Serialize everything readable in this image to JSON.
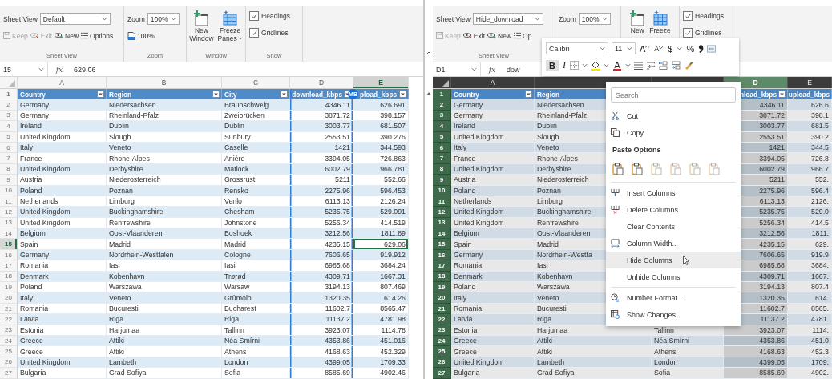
{
  "windows": [
    {
      "ribbon": [
        {
          "kind": "sheet_view",
          "label": "Sheet View",
          "dropdown_label": "Sheet View",
          "value": "Default",
          "buttons": [
            {
              "label": "Keep",
              "disabled": true
            },
            {
              "label": "Exit",
              "disabled": true
            },
            {
              "label": "New",
              "disabled": false
            },
            {
              "label": "Options",
              "disabled": false
            }
          ]
        },
        {
          "kind": "zoom",
          "label": "Zoom",
          "dropdown_label": "Zoom",
          "value": "100%",
          "button": "100%"
        },
        {
          "kind": "window",
          "label": "Window",
          "buttons": [
            {
              "lines": [
                "New",
                "Window"
              ],
              "dropdown": false
            },
            {
              "lines": [
                "Freeze",
                "Panes"
              ],
              "dropdown": true
            }
          ]
        },
        {
          "kind": "show",
          "label": "Show",
          "checkboxes": [
            {
              "label": "Headings",
              "checked": true
            },
            {
              "label": "Gridlines",
              "checked": true
            }
          ]
        }
      ],
      "formula_bar": {
        "name_box": "15",
        "function_label": "fx",
        "value": "629.06"
      },
      "sheet": {
        "column_letters": {
          "country": {
            "label": "A",
            "selected": false,
            "whole_column": false
          },
          "region": {
            "label": "B",
            "selected": false,
            "whole_column": false
          },
          "city": {
            "label": "C",
            "selected": false,
            "whole_column": false
          },
          "download": {
            "label": "D",
            "selected": false,
            "whole_column": false,
            "collaborator_initials": "MB"
          },
          "upload": {
            "label": "E",
            "selected": true,
            "whole_column": false
          }
        },
        "header_row": {
          "number": "1",
          "cells": {
            "country": "Country",
            "region": "Region",
            "city": "City",
            "download": "download_kbps",
            "upload": "pload_kbps"
          }
        },
        "rows": [
          {
            "number": "2",
            "selected": false,
            "country": "Germany",
            "region": "Niedersachsen",
            "city": "Braunschweig",
            "download": "4346.11",
            "upload": "626.691"
          },
          {
            "number": "3",
            "selected": false,
            "country": "Germany",
            "region": "Rheinland-Pfalz",
            "city": "Zweibrücken",
            "download": "3871.72",
            "upload": "398.157"
          },
          {
            "number": "4",
            "selected": false,
            "country": "Ireland",
            "region": "Dublin",
            "city": "Dublin",
            "download": "3003.77",
            "upload": "681.507"
          },
          {
            "number": "5",
            "selected": false,
            "country": "United Kingdom",
            "region": "Slough",
            "city": "Sunbury",
            "download": "2553.51",
            "upload": "390.276"
          },
          {
            "number": "6",
            "selected": false,
            "country": "Italy",
            "region": "Veneto",
            "city": "Caselle",
            "download": "1421",
            "upload": "344.593"
          },
          {
            "number": "7",
            "selected": false,
            "country": "France",
            "region": "Rhone-Alpes",
            "city": "Anière",
            "download": "3394.05",
            "upload": "726.863"
          },
          {
            "number": "8",
            "selected": false,
            "country": "United Kingdom",
            "region": "Derbyshire",
            "city": "Matlock",
            "download": "6002.79",
            "upload": "966.781"
          },
          {
            "number": "9",
            "selected": false,
            "country": "Austria",
            "region": "Niederosterreich",
            "city": "Grossrust",
            "download": "5211",
            "upload": "552.66"
          },
          {
            "number": "10",
            "selected": false,
            "country": "Poland",
            "region": "Poznan",
            "city": "Rensko",
            "download": "2275.96",
            "upload": "596.453"
          },
          {
            "number": "11",
            "selected": false,
            "country": "Netherlands",
            "region": "Limburg",
            "city": "Venlo",
            "download": "6113.13",
            "upload": "2126.24"
          },
          {
            "number": "12",
            "selected": false,
            "country": "United Kingdom",
            "region": "Buckinghamshire",
            "city": "Chesham",
            "download": "5235.75",
            "upload": "529.091"
          },
          {
            "number": "13",
            "selected": false,
            "country": "United Kingdom",
            "region": "Renfrewshire",
            "city": "Johnstone",
            "download": "5256.34",
            "upload": "414.519"
          },
          {
            "number": "14",
            "selected": false,
            "country": "Belgium",
            "region": "Oost-Vlaanderen",
            "city": "Boshoek",
            "download": "3212.56",
            "upload": "1811.89"
          },
          {
            "number": "15",
            "selected": true,
            "country": "Spain",
            "region": "Madrid",
            "city": "Madrid",
            "download": "4235.15",
            "upload": "629.06"
          },
          {
            "number": "16",
            "selected": false,
            "country": "Germany",
            "region": "Nordrhein-Westfalen",
            "city": "Cologne",
            "download": "7606.65",
            "upload": "919.912"
          },
          {
            "number": "17",
            "selected": false,
            "country": "Romania",
            "region": "Iasi",
            "city": "Iasi",
            "download": "6985.68",
            "upload": "3684.24"
          },
          {
            "number": "18",
            "selected": false,
            "country": "Denmark",
            "region": "Kobenhavn",
            "city": "Trørød",
            "download": "4309.71",
            "upload": "1667.31"
          },
          {
            "number": "19",
            "selected": false,
            "country": "Poland",
            "region": "Warszawa",
            "city": "Warsaw",
            "download": "3194.13",
            "upload": "807.469"
          },
          {
            "number": "20",
            "selected": false,
            "country": "Italy",
            "region": "Veneto",
            "city": "Grùmolo",
            "download": "1320.35",
            "upload": "614.26"
          },
          {
            "number": "21",
            "selected": false,
            "country": "Romania",
            "region": "Bucuresti",
            "city": "Bucharest",
            "download": "11602.7",
            "upload": "8565.47"
          },
          {
            "number": "22",
            "selected": false,
            "country": "Latvia",
            "region": "Riga",
            "city": "Riga",
            "download": "11137.2",
            "upload": "4781.98"
          },
          {
            "number": "23",
            "selected": false,
            "country": "Estonia",
            "region": "Harjumaa",
            "city": "Tallinn",
            "download": "3923.07",
            "upload": "1114.78"
          },
          {
            "number": "24",
            "selected": false,
            "country": "Greece",
            "region": "Attiki",
            "city": "Néa Smírni",
            "download": "4353.86",
            "upload": "451.016"
          },
          {
            "number": "25",
            "selected": false,
            "country": "Greece",
            "region": "Attiki",
            "city": "Athens",
            "download": "4168.63",
            "upload": "452.329"
          },
          {
            "number": "26",
            "selected": false,
            "country": "United Kingdom",
            "region": "Lambeth",
            "city": "London",
            "download": "4399.05",
            "upload": "1709.33"
          },
          {
            "number": "27",
            "selected": false,
            "country": "Bulgaria",
            "region": "Grad Sofiya",
            "city": "Sofia",
            "download": "8585.69",
            "upload": "4902.46"
          }
        ]
      }
    },
    {
      "ribbon": [
        {
          "kind": "sheet_view",
          "label": "Sheet View",
          "dropdown_label": "Sheet View",
          "value": "Hide_download",
          "buttons": [
            {
              "label": "Keep",
              "disabled": true
            },
            {
              "label": "Exit",
              "disabled": false
            },
            {
              "label": "New",
              "disabled": false
            },
            {
              "label": "Op",
              "disabled": false
            }
          ]
        },
        {
          "kind": "zoom",
          "dropdown_label": "Zoom",
          "value": "100%"
        },
        {
          "kind": "window",
          "buttons": [
            {
              "lines": [
                "New"
              ],
              "dropdown": false
            },
            {
              "lines": [
                "Freeze"
              ],
              "dropdown": false
            }
          ]
        },
        {
          "kind": "show",
          "checkboxes": [
            {
              "label": "Headings",
              "checked": true
            },
            {
              "label": "Gridlines",
              "checked": true
            }
          ]
        }
      ],
      "formula_bar": {
        "name_box": "D1",
        "function_label": "fx",
        "value": "dow"
      },
      "sheet": {
        "column_letters": {
          "country": {
            "label": "A",
            "selected": false,
            "whole_column": false
          },
          "download": {
            "label": "D",
            "selected": true,
            "whole_column": true
          },
          "upload": {
            "label": "E",
            "selected": false,
            "whole_column": false
          }
        },
        "header_row": {
          "number": "1",
          "cells": {
            "country": "Country",
            "region": "Region",
            "download": "nload_kbps",
            "upload": "upload_kbps"
          }
        },
        "rows": [
          {
            "number": "2",
            "selected": false,
            "country": "Germany",
            "region": "Niedersachsen",
            "download": "4346.11",
            "upload": "626.6"
          },
          {
            "number": "3",
            "selected": false,
            "country": "Germany",
            "region": "Rheinland-Pfalz",
            "download": "3871.72",
            "upload": "398.1"
          },
          {
            "number": "4",
            "selected": false,
            "country": "Ireland",
            "region": "Dublin",
            "download": "3003.77",
            "upload": "681.5"
          },
          {
            "number": "5",
            "selected": false,
            "country": "United Kingdom",
            "region": "Slough",
            "download": "2553.51",
            "upload": "390.2"
          },
          {
            "number": "6",
            "selected": false,
            "country": "Italy",
            "region": "Veneto",
            "download": "1421",
            "upload": "344.5"
          },
          {
            "number": "7",
            "selected": false,
            "country": "France",
            "region": "Rhone-Alpes",
            "download": "3394.05",
            "upload": "726.8"
          },
          {
            "number": "8",
            "selected": false,
            "country": "United Kingdom",
            "region": "Derbyshire",
            "download": "6002.79",
            "upload": "966.7"
          },
          {
            "number": "9",
            "selected": false,
            "country": "Austria",
            "region": "Niederosterreich",
            "download": "5211",
            "upload": "552."
          },
          {
            "number": "10",
            "selected": false,
            "country": "Poland",
            "region": "Poznan",
            "download": "2275.96",
            "upload": "596.4"
          },
          {
            "number": "11",
            "selected": false,
            "country": "Netherlands",
            "region": "Limburg",
            "download": "6113.13",
            "upload": "2126."
          },
          {
            "number": "12",
            "selected": false,
            "country": "United Kingdom",
            "region": "Buckinghamshire",
            "download": "5235.75",
            "upload": "529.0"
          },
          {
            "number": "13",
            "selected": false,
            "country": "United Kingdom",
            "region": "Renfrewshire",
            "download": "5256.34",
            "upload": "414.5"
          },
          {
            "number": "14",
            "selected": false,
            "country": "Belgium",
            "region": "Oost-Vlaanderen",
            "download": "3212.56",
            "upload": "1811."
          },
          {
            "number": "15",
            "selected": false,
            "country": "Spain",
            "region": "Madrid",
            "download": "4235.15",
            "upload": "629."
          },
          {
            "number": "16",
            "selected": false,
            "country": "Germany",
            "region": "Nordrhein-Westfa",
            "download": "7606.65",
            "upload": "919.9"
          },
          {
            "number": "17",
            "selected": false,
            "country": "Romania",
            "region": "Iasi",
            "download": "6985.68",
            "upload": "3684."
          },
          {
            "number": "18",
            "selected": false,
            "country": "Denmark",
            "region": "Kobenhavn",
            "download": "4309.71",
            "upload": "1667."
          },
          {
            "number": "19",
            "selected": false,
            "country": "Poland",
            "region": "Warszawa",
            "download": "3194.13",
            "upload": "807.4"
          },
          {
            "number": "20",
            "selected": false,
            "country": "Italy",
            "region": "Veneto",
            "download": "1320.35",
            "upload": "614."
          },
          {
            "number": "21",
            "selected": false,
            "country": "Romania",
            "region": "Bucuresti",
            "download": "11602.7",
            "upload": "8565."
          },
          {
            "number": "22",
            "selected": false,
            "country": "Latvia",
            "region": "Riga",
            "download": "11137.2",
            "upload": "4781."
          },
          {
            "number": "23",
            "selected": false,
            "country": "Estonia",
            "region": "Harjumaa",
            "city": "Tallinn",
            "download": "3923.07",
            "upload": "1114."
          },
          {
            "number": "24",
            "selected": false,
            "country": "Greece",
            "region": "Attiki",
            "city": "Néa Smírni",
            "download": "4353.86",
            "upload": "451.0"
          },
          {
            "number": "25",
            "selected": false,
            "country": "Greece",
            "region": "Attiki",
            "city": "Athens",
            "download": "4168.63",
            "upload": "452.3"
          },
          {
            "number": "26",
            "selected": false,
            "country": "United Kingdom",
            "region": "Lambeth",
            "city": "London",
            "download": "4399.05",
            "upload": "1709."
          },
          {
            "number": "27",
            "selected": false,
            "country": "Bulgaria",
            "region": "Grad Sofiya",
            "city": "Sofia",
            "download": "8585.69",
            "upload": "4902."
          }
        ]
      },
      "mini_toolbar": {
        "font": "Calibri",
        "size": "11",
        "grow_font": "A",
        "shrink_font": "A",
        "currency": "$",
        "percent": "%",
        "bold": {
          "label": "B",
          "selected": true
        },
        "italic": "I",
        "font_color": "A"
      },
      "context_menu": {
        "search_placeholder": "Search",
        "items": [
          {
            "kind": "cut",
            "label": "Cut",
            "selected": false
          },
          {
            "kind": "copy",
            "label": "Copy",
            "selected": false
          },
          {
            "kind": "heading",
            "label": "Paste Options"
          },
          {
            "kind": "paste"
          },
          {
            "kind": "separator"
          },
          {
            "kind": "insert",
            "label": "Insert Columns",
            "selected": false
          },
          {
            "kind": "delete",
            "label": "Delete Columns",
            "selected": false
          },
          {
            "kind": "plain",
            "label": "Clear Contents",
            "selected": false
          },
          {
            "kind": "width",
            "label": "Column Width...",
            "selected": false
          },
          {
            "kind": "plain",
            "label": "Hide Columns",
            "selected": true
          },
          {
            "kind": "plain",
            "label": "Unhide Columns",
            "selected": false
          },
          {
            "kind": "separator"
          },
          {
            "kind": "format",
            "label": "Number Format...",
            "selected": false
          },
          {
            "kind": "changes",
            "label": "Show Changes",
            "selected": false
          }
        ]
      }
    }
  ]
}
